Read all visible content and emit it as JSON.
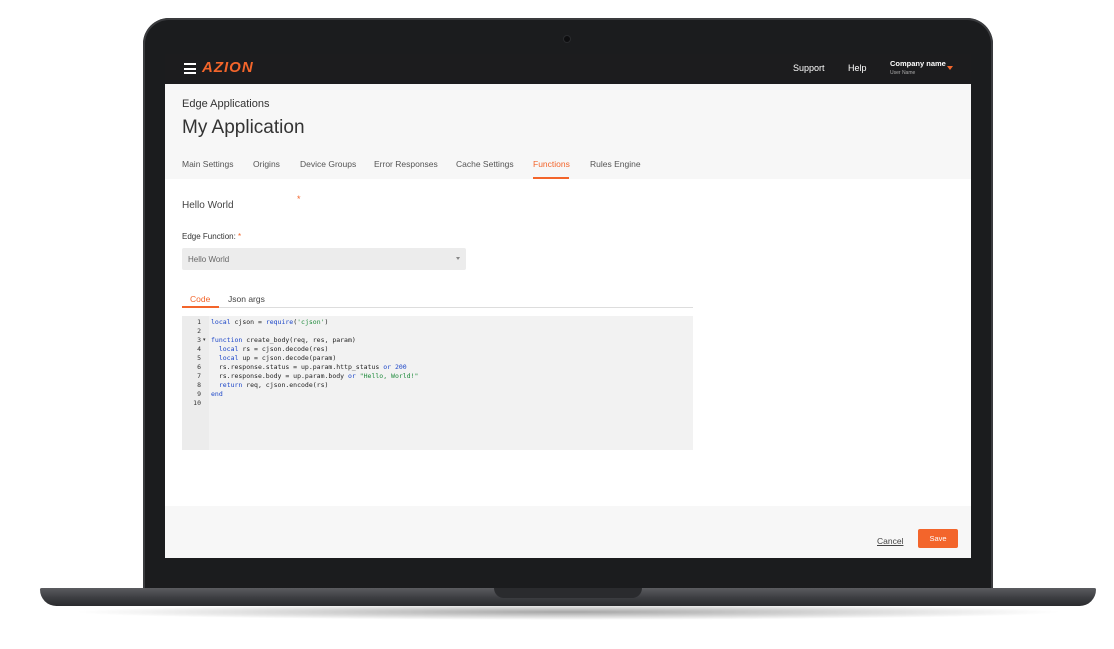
{
  "topbar": {
    "logo": "AZION",
    "links": [
      "Support",
      "Help"
    ],
    "company_name": "Company name",
    "user_name": "User Name"
  },
  "header": {
    "breadcrumb": "Edge Applications",
    "title": "My Application",
    "tabs": [
      "Main Settings",
      "Origins",
      "Device Groups",
      "Error Responses",
      "Cache Settings",
      "Functions",
      "Rules Engine"
    ],
    "active_tab": "Functions"
  },
  "form": {
    "function_name": "Hello World",
    "required_mark": "*",
    "edge_function_label": "Edge Function:",
    "edge_function_value": "Hello World",
    "code_tabs": [
      "Code",
      "Json args"
    ],
    "active_code_tab": "Code"
  },
  "editor": {
    "line_numbers": [
      "1",
      "2",
      "3",
      "4",
      "5",
      "6",
      "7",
      "8",
      "9",
      "10"
    ],
    "lines": [
      "local cjson = require('cjson')",
      "",
      "function create_body(req, res, param)",
      "  local rs = cjson.decode(res)",
      "  local up = cjson.decode(param)",
      "  rs.response.status = up.param.http_status or 200",
      "  rs.response.body = up.param.body or \"Hello, World!\"",
      "  return req, cjson.encode(rs)",
      "end",
      ""
    ]
  },
  "footer": {
    "cancel_label": "Cancel",
    "save_label": "Save"
  },
  "colors": {
    "accent": "#f3652b",
    "topbar": "#1c1c1e",
    "keyword": "#1b45c8",
    "string": "#1d8a3a"
  }
}
